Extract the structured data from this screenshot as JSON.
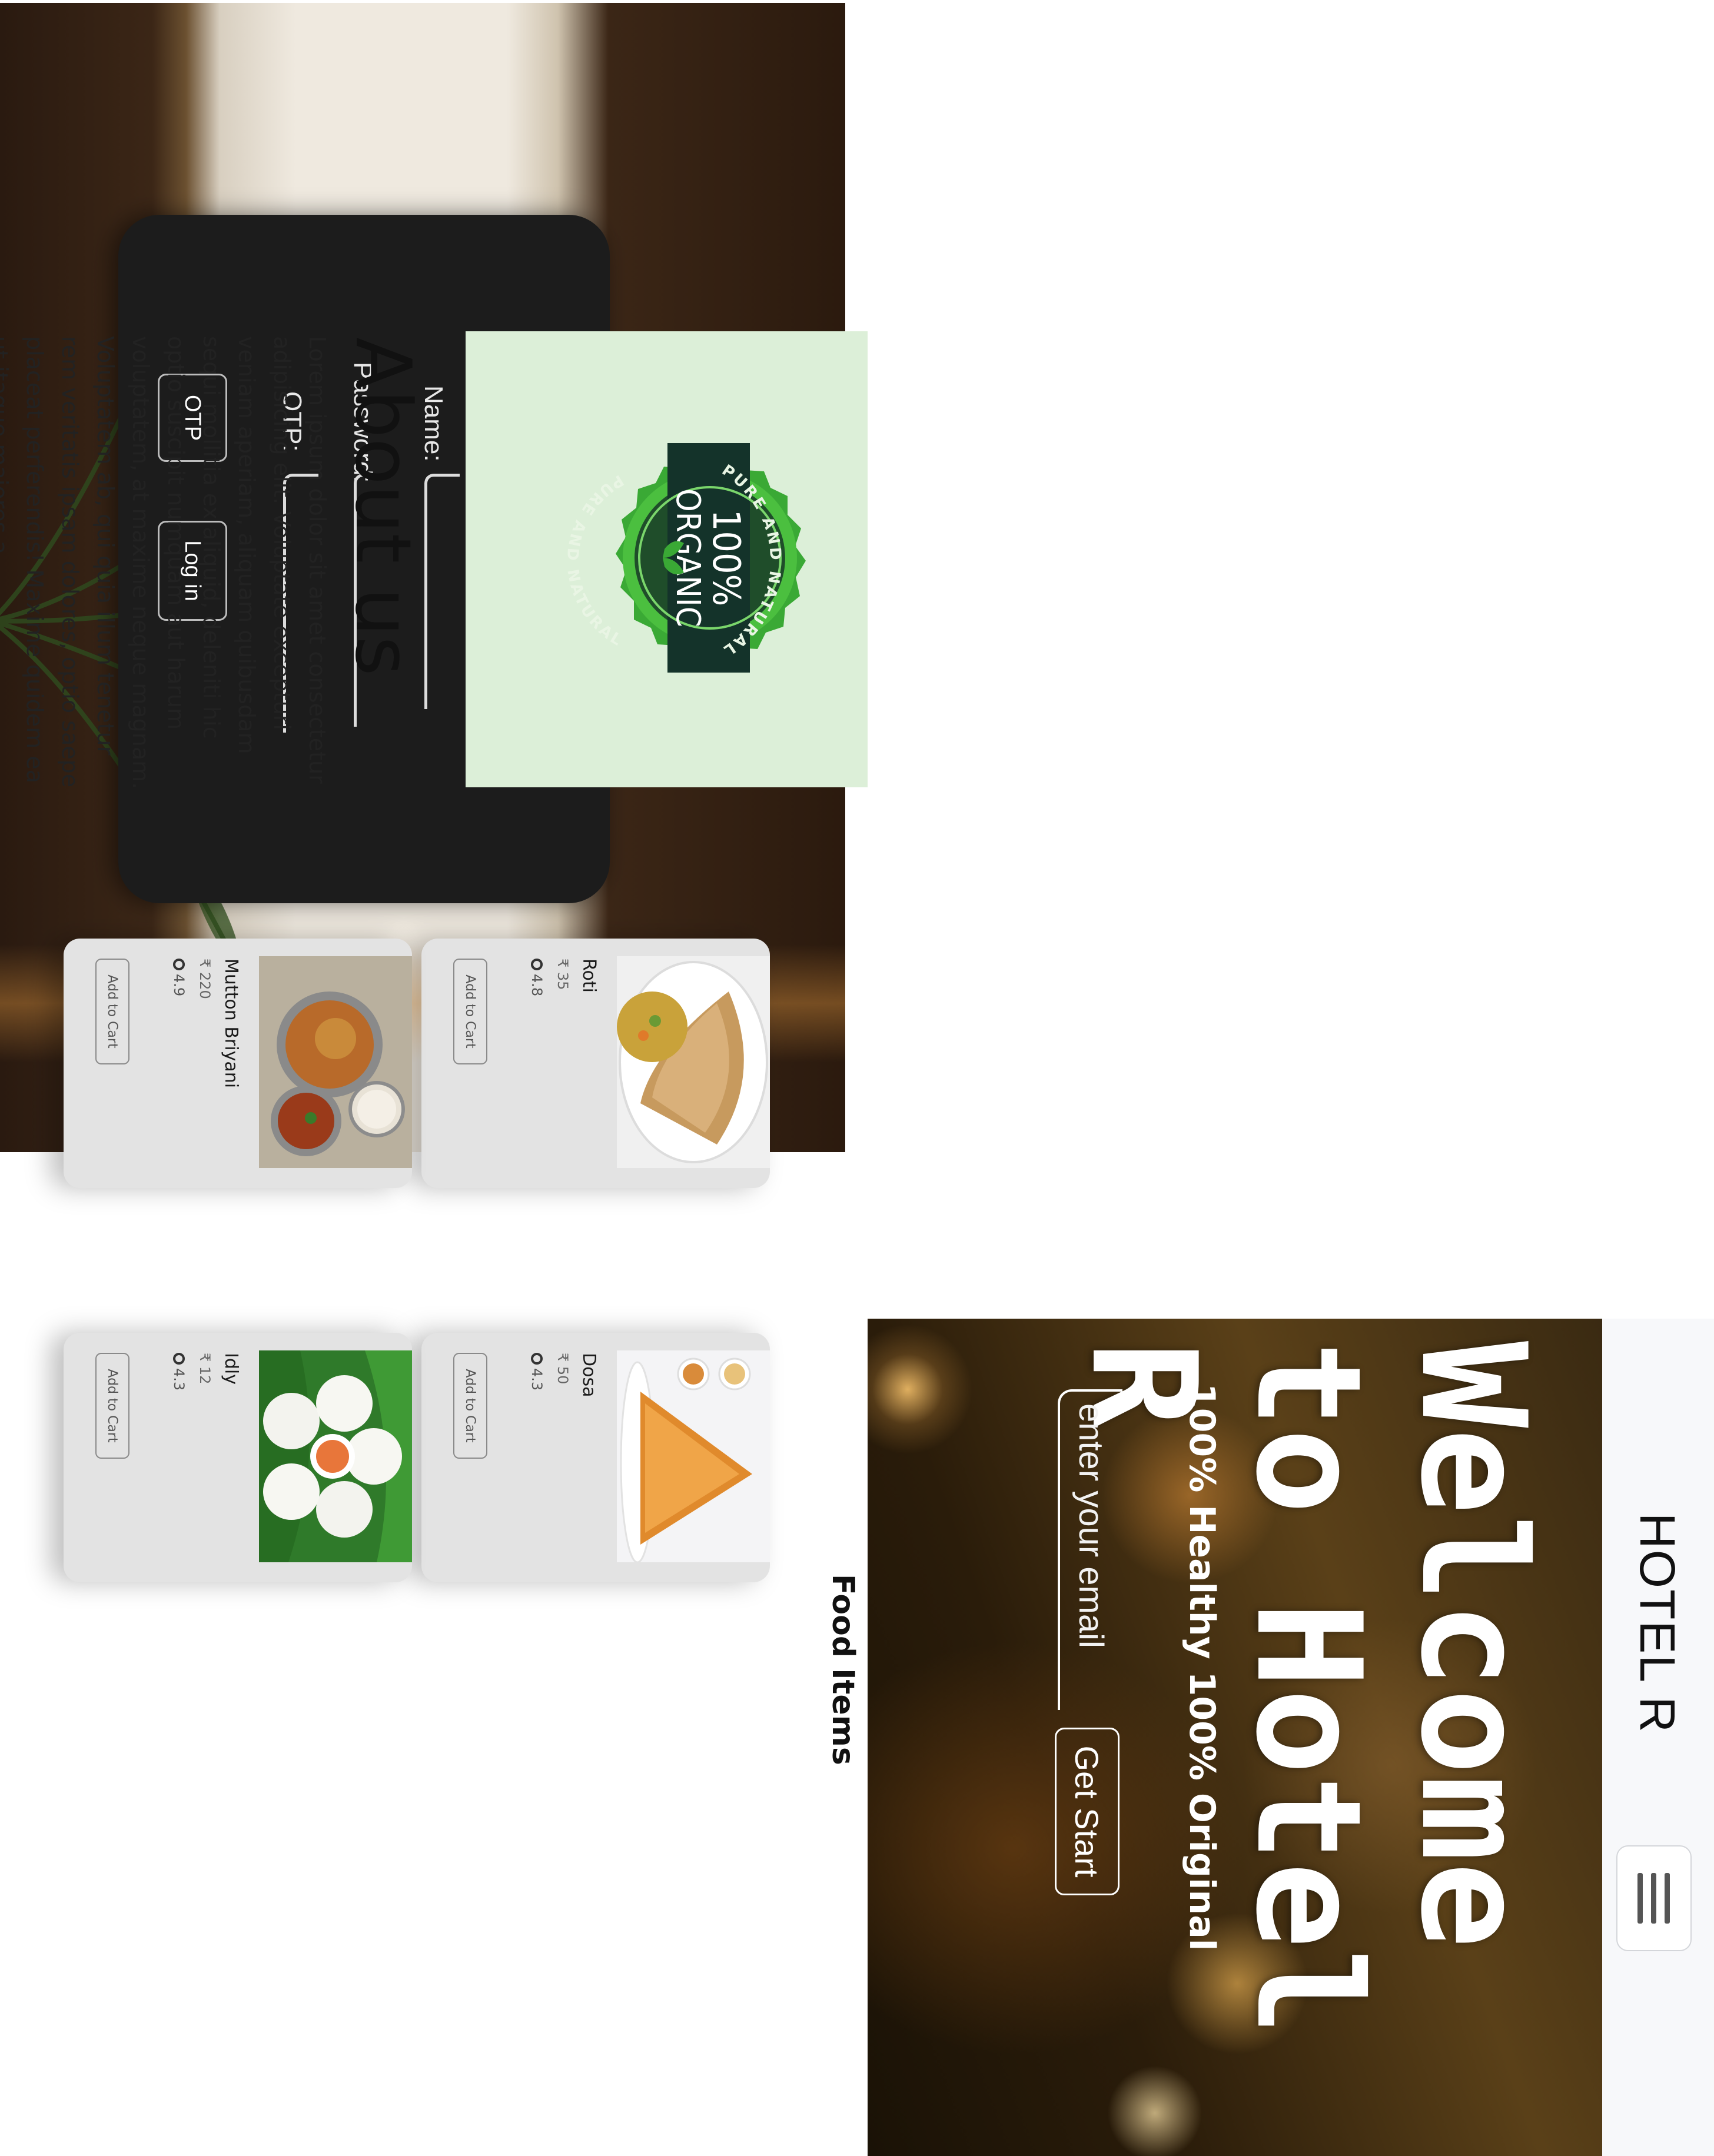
{
  "home": {
    "brand": "HOTEL R",
    "hero_title_line1": "Welcome",
    "hero_title_line2": "to Hotel R",
    "hero_subtitle": "100% Healthy 100% Original",
    "email_placeholder": "enter your email",
    "get_start_label": "Get Start"
  },
  "food": {
    "title": "Food Items",
    "add_to_cart_label": "Add to Cart",
    "items": [
      {
        "name": "Dosa",
        "price": "₹ 50",
        "rating": "4.3",
        "image": "dosa"
      },
      {
        "name": "Idly",
        "price": "₹ 12",
        "rating": "4.3",
        "image": "idly"
      },
      {
        "name": "Roti",
        "price": "₹ 35",
        "rating": "4.8",
        "image": "roti"
      },
      {
        "name": "Mutton Briyani",
        "price": "₹ 220",
        "rating": "4.9",
        "image": "briyani"
      }
    ]
  },
  "login": {
    "title": "Log in",
    "name_label": "Name:",
    "password_label": "Password:",
    "otp_label": "OTP:",
    "otp_button": "OTP",
    "login_button": "Log in"
  },
  "about": {
    "badge_text_top": "PURE AND NATURAL",
    "badge_text_main_1": "100%",
    "badge_text_main_2": "ORGANIC",
    "badge_text_bottom": "PURE AND NATURAL",
    "title": "About us",
    "body": "Lorem ipsum dolor sit amet consectetur adipisicing elit. Voluptate excepturi veniam aperiam, aliquam quibusdam sequi mollitia ex aliquid, deleniti hic optio suscipit numquam aut harum voluptatem, at maxime neque magnam. Voluptatem ab, qui quia illum tenetur rem veritatis ipsam dolores, optio saepe placeat perferendis! Maxime quidem ea ut itaque maiores a,"
  },
  "icons": {
    "menu": "hamburger-menu-icon",
    "rating": "star-icon",
    "badge": "organic-leaf-badge"
  },
  "colors": {
    "login_card": "#1c1c1c",
    "badge_green": "#3aa935",
    "badge_dark": "#14332a",
    "about_bg": "#dcefd8",
    "card_bg": "#e3e3e3"
  }
}
